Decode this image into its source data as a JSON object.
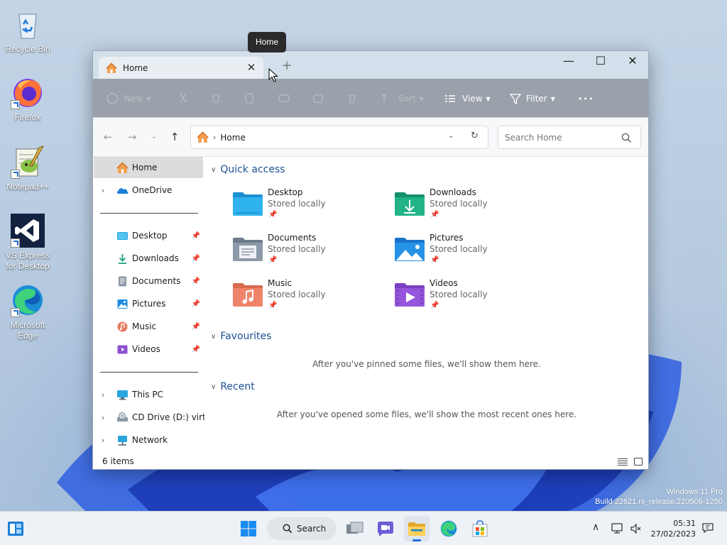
{
  "desktop": {
    "icons": [
      {
        "label": "Recycle Bin"
      },
      {
        "label": "Firefox"
      },
      {
        "label": "Notepad++"
      },
      {
        "label": "VS Express for Desktop"
      },
      {
        "label": "Microsoft Edge"
      }
    ],
    "watermark": {
      "line1": "Windows 11 Pro",
      "line2": "Build 22621.ni_release.220506-1250"
    }
  },
  "tooltip": {
    "text": "Home"
  },
  "window": {
    "tab": {
      "label": "Home",
      "close": "✕"
    },
    "new_tab": "+",
    "controls": {
      "minimize": "—",
      "maximize": "☐",
      "close": "✕"
    },
    "toolbar": {
      "new_label": "New",
      "sort_label": "Sort",
      "view_label": "View",
      "filter_label": "Filter",
      "more_label": "•••"
    },
    "address": {
      "location": "Home",
      "search_placeholder": "Search Home"
    },
    "nav": {
      "home": "Home",
      "onedrive": "OneDrive",
      "pinned": [
        {
          "label": "Desktop"
        },
        {
          "label": "Downloads"
        },
        {
          "label": "Documents"
        },
        {
          "label": "Pictures"
        },
        {
          "label": "Music"
        },
        {
          "label": "Videos"
        }
      ],
      "this_pc": "This PC",
      "cd_drive": "CD Drive (D:) virtio-",
      "network": "Network"
    },
    "content": {
      "quick_access_title": "Quick access",
      "folders": [
        {
          "name": "Desktop",
          "sub": "Stored locally"
        },
        {
          "name": "Downloads",
          "sub": "Stored locally"
        },
        {
          "name": "Documents",
          "sub": "Stored locally"
        },
        {
          "name": "Pictures",
          "sub": "Stored locally"
        },
        {
          "name": "Music",
          "sub": "Stored locally"
        },
        {
          "name": "Videos",
          "sub": "Stored locally"
        }
      ],
      "favourites_title": "Favourites",
      "favourites_empty": "After you've pinned some files, we'll show them here.",
      "recent_title": "Recent",
      "recent_empty": "After you've opened some files, we'll show the most recent ones here."
    },
    "status": {
      "item_count": "6 items"
    }
  },
  "taskbar": {
    "search_label": "Search",
    "time": "05:31",
    "date": "27/02/2023"
  },
  "colors": {
    "accent": "#1f6fe0",
    "toolbar_bg": "#9aa1aa",
    "section_title": "#1d4f91"
  }
}
